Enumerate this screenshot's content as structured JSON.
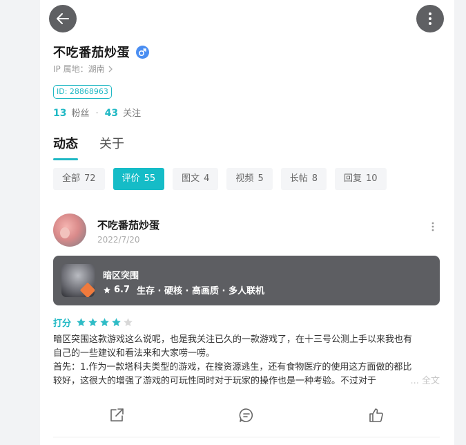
{
  "header": {
    "back_icon": "arrow-left-icon",
    "more_icon": "vertical-dots-icon"
  },
  "profile": {
    "name": "不吃番茄炒蛋",
    "gender_icon": "male-icon",
    "ip_location": "IP 属地：湖南",
    "id_badge": "ID: 28868963",
    "followers_count": "13",
    "followers_label": "粉丝",
    "separator": "·",
    "following_count": "43",
    "following_label": "关注"
  },
  "tabs": [
    {
      "label": "动态",
      "active": true
    },
    {
      "label": "关于",
      "active": false
    }
  ],
  "filters": [
    {
      "label": "全部",
      "count": "72",
      "active": false
    },
    {
      "label": "评价",
      "count": "55",
      "active": true
    },
    {
      "label": "图文",
      "count": "4",
      "active": false
    },
    {
      "label": "视频",
      "count": "5",
      "active": false
    },
    {
      "label": "长帖",
      "count": "8",
      "active": false
    },
    {
      "label": "回复",
      "count": "10",
      "active": false
    }
  ],
  "post": {
    "author": "不吃番茄炒蛋",
    "date": "2022/7/20",
    "game": {
      "name": "暗区突围",
      "score": "6.7",
      "tags": "生存 · 硬核 · 高画质 · 多人联机"
    },
    "rating_label": "打分",
    "rating": 4,
    "rating_max": 5,
    "lines": [
      "暗区突围这款游戏这么说呢，也是我关注已久的一款游戏了，在十三号公测上手以来我也有",
      "自己的一些建议和看法来和大家唠一唠。",
      "首先：1.作为一款塔科夫类型的游戏，在搜资源逃生，还有食物医疗的使用这方面做的都比",
      "较好，这很大的增强了游戏的可玩性同时对于玩家的操作也是一种考验。不过对于"
    ],
    "more_text": "... 全文"
  },
  "colors": {
    "accent": "#1fb8c4",
    "chip_active": "#15bcc7",
    "card_bg": "#5d5e62",
    "star_on": "#2fbcc6",
    "star_off": "#d8d8d8"
  },
  "actions": [
    {
      "name": "share",
      "icon": "share-icon"
    },
    {
      "name": "comment",
      "icon": "comment-icon"
    },
    {
      "name": "like",
      "icon": "thumbs-up-icon"
    }
  ]
}
